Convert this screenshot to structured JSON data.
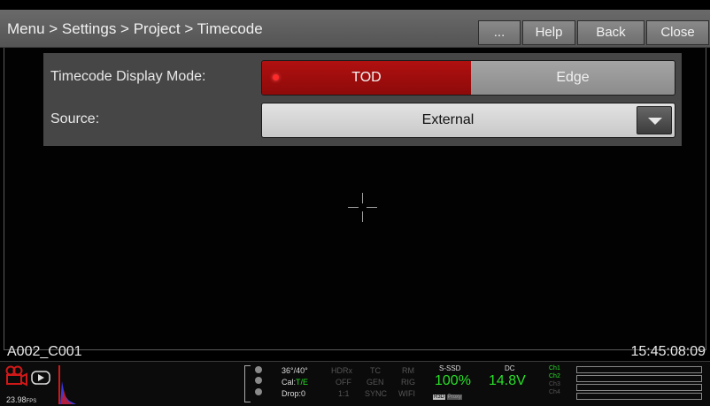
{
  "header": {
    "breadcrumb": "Menu > Settings > Project > Timecode",
    "more_label": "...",
    "help_label": "Help",
    "back_label": "Back",
    "close_label": "Close"
  },
  "settings": {
    "display_mode": {
      "label": "Timecode Display Mode:",
      "options": [
        "TOD",
        "Edge"
      ],
      "selected": "TOD"
    },
    "source": {
      "label": "Source:",
      "value": "External"
    }
  },
  "overlay": {
    "clip_name": "A002_C001",
    "timecode": "15:45:08:09"
  },
  "status": {
    "fps": "23.98",
    "fps_unit": "FPS",
    "temp": "36°/40°",
    "cal_prefix": "Cal:",
    "cal_value": "T/E",
    "drop": "Drop:0",
    "hdrx_label": "HDRx",
    "hdrx_value": "OFF",
    "ratio": "1:1",
    "tc_label": "TC",
    "tc_value": "GEN",
    "tc_sync": "SYNC",
    "rm_label": "RM",
    "rm_value": "RIG",
    "rm_wifi": "WIFI",
    "media_label": "S-SSD",
    "media_percent": "100%",
    "media_badge_a": "R3D",
    "media_badge_b": "Proxy",
    "power_label": "DC",
    "power_value": "14.8V",
    "channels": [
      "Ch1",
      "Ch2",
      "Ch3",
      "Ch4"
    ],
    "accent_red": "#b01010",
    "accent_green": "#29e029"
  }
}
